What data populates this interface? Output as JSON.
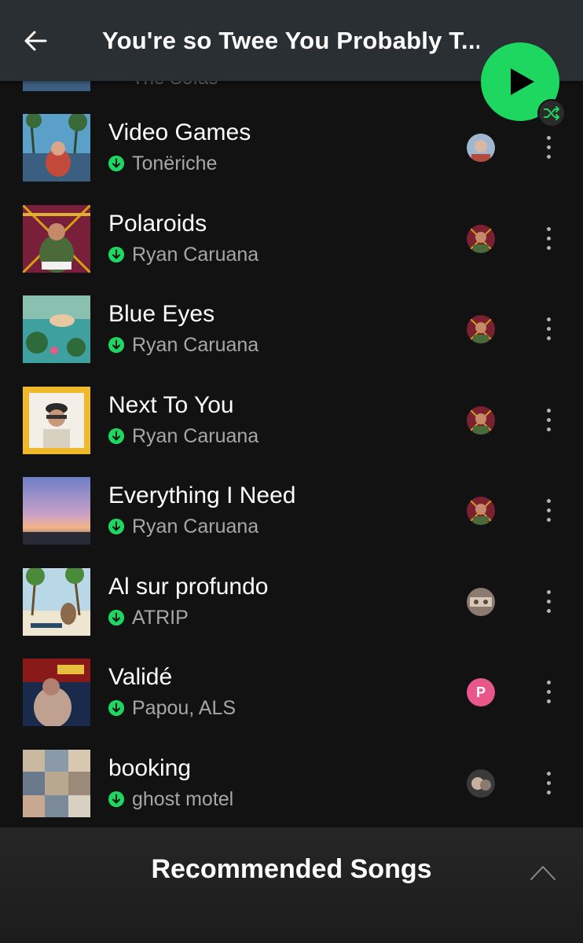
{
  "header": {
    "title": "You're so Twee You Probably T..."
  },
  "peek": {
    "subtitle": "The Sofas"
  },
  "tracks": [
    {
      "title": "Video Games",
      "artist": "Tonëriche"
    },
    {
      "title": "Polaroids",
      "artist": "Ryan Caruana"
    },
    {
      "title": "Blue Eyes",
      "artist": "Ryan Caruana"
    },
    {
      "title": "Next To You",
      "artist": "Ryan Caruana"
    },
    {
      "title": "Everything I Need",
      "artist": "Ryan Caruana"
    },
    {
      "title": "Al sur profundo",
      "artist": "ATRIP"
    },
    {
      "title": "Validé",
      "artist": "Papou, ALS",
      "avatar_letter": "P"
    },
    {
      "title": "booking",
      "artist": "ghost motel"
    }
  ],
  "recommended": {
    "title": "Recommended Songs"
  },
  "colors": {
    "accent": "#1ed760",
    "background": "#121212",
    "header": "#2a2f33",
    "secondary_text": "#a7a7a7",
    "avatar_pink": "#e8578a"
  },
  "icons": {
    "back": "arrow-left-icon",
    "play": "play-icon",
    "shuffle": "shuffle-icon",
    "download": "downloaded-icon",
    "more": "more-vertical-icon",
    "chevron": "chevron-up-icon"
  }
}
